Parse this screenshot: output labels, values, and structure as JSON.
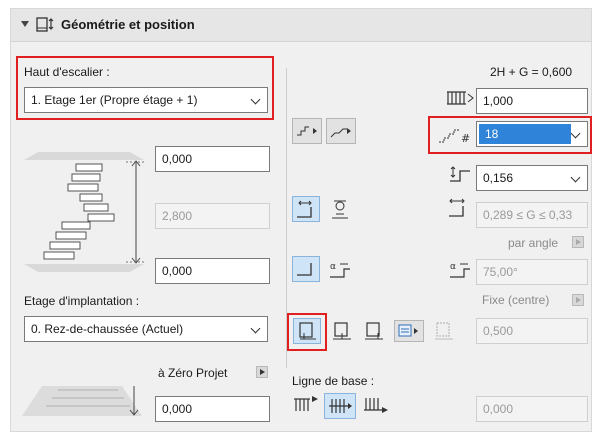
{
  "header": {
    "title": "Géométrie et position"
  },
  "haut": {
    "label": "Haut d'escalier :",
    "value": "1. Etage 1er (Propre étage + 1)"
  },
  "formula": "2H + G = 0,600",
  "fields": {
    "top_level": "0,000",
    "height": "2,800",
    "bottom_level": "0,000",
    "flight_width": "1,000",
    "riser_count": "18",
    "riser_height": "0,156",
    "going_range": "0,289 ≤ G ≤ 0,33",
    "angle": "75,00°",
    "offset": "0,500",
    "zero_value": "0,000",
    "baseline_value": "0,000"
  },
  "labels": {
    "par_angle": "par angle",
    "fixe_centre": "Fixe (centre)",
    "etage_impl": "Etage d'implantation :",
    "zero_projet": "à Zéro Projet",
    "ligne_base": "Ligne de base :"
  },
  "etage": {
    "value": "0. Rez-de-chaussée (Actuel)"
  },
  "colors": {
    "highlight": "#e02020",
    "selection": "#2f83d8"
  },
  "icons": [
    "collapse-arrow-icon",
    "stair-geometry-icon",
    "flight-width-icon",
    "riser-count-icon",
    "riser-height-icon",
    "going-icon",
    "angle-icon",
    "stair-preview-icon",
    "zero-projet-preview-icon"
  ]
}
